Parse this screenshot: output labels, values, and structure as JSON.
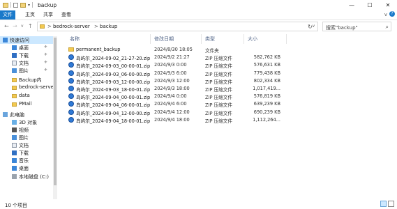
{
  "window": {
    "path_title": "backup",
    "controls": {
      "minimize": "—",
      "maximize": "☐",
      "close": "✕"
    }
  },
  "ribbon": {
    "tabs": [
      "文件",
      "主页",
      "共享",
      "查看"
    ],
    "expand": "v",
    "help": "?"
  },
  "address_bar": {
    "back": "←",
    "forward": "→",
    "recent": "v",
    "up": "↑",
    "crumbs": [
      "bedrock-server",
      "backup"
    ],
    "separator": ">",
    "dropdown": "v",
    "refresh": "↻",
    "search_placeholder": "搜索\"backup\"",
    "search_icon": "⌕"
  },
  "sidebar": {
    "items": [
      {
        "label": "快速访问",
        "icon": "star-icon",
        "pinned": false,
        "active": true
      },
      {
        "label": "桌面",
        "icon": "desktop-icon",
        "pinned": true
      },
      {
        "label": "下载",
        "icon": "download-icon",
        "pinned": true
      },
      {
        "label": "文档",
        "icon": "document-icon",
        "pinned": true
      },
      {
        "label": "图片",
        "icon": "picture-icon",
        "pinned": true
      },
      {
        "label": "Backup内",
        "icon": "folder-icon",
        "pinned": false
      },
      {
        "label": "bedrock-server",
        "icon": "folder-icon",
        "pinned": false
      },
      {
        "label": "data",
        "icon": "folder-icon",
        "pinned": false
      },
      {
        "label": "PMail",
        "icon": "folder-icon",
        "pinned": false
      },
      {
        "label": "此电脑",
        "icon": "pc-icon",
        "pinned": false
      },
      {
        "label": "3D 对象",
        "icon": "cube-icon",
        "pinned": false
      },
      {
        "label": "视频",
        "icon": "video-icon",
        "pinned": false
      },
      {
        "label": "图片",
        "icon": "picture-icon",
        "pinned": false
      },
      {
        "label": "文档",
        "icon": "document-icon",
        "pinned": false
      },
      {
        "label": "下载",
        "icon": "download-icon",
        "pinned": false
      },
      {
        "label": "音乐",
        "icon": "music-icon",
        "pinned": false
      },
      {
        "label": "桌面",
        "icon": "desktop-icon",
        "pinned": false
      },
      {
        "label": "本地磁盘 (C:)",
        "icon": "drive-icon",
        "pinned": false
      }
    ],
    "pin_glyph": "✈"
  },
  "columns": {
    "name": "名称",
    "date": "修改日期",
    "type": "类型",
    "size": "大小"
  },
  "files": [
    {
      "name": "permanent_backup",
      "date": "2024/8/30 18:05",
      "type": "文件夹",
      "size": "",
      "kind": "folder"
    },
    {
      "name": "岛屿尔_2024-09-02_21-27-20.zip",
      "date": "2024/9/2 21:27",
      "type": "ZIP 压缩文件",
      "size": "582,762 KB",
      "kind": "zip"
    },
    {
      "name": "岛屿尔_2024-09-03_00-00-01.zip",
      "date": "2024/9/3 0:00",
      "type": "ZIP 压缩文件",
      "size": "576,631 KB",
      "kind": "zip"
    },
    {
      "name": "岛屿尔_2024-09-03_06-00-00.zip",
      "date": "2024/9/3 6:00",
      "type": "ZIP 压缩文件",
      "size": "779,438 KB",
      "kind": "zip"
    },
    {
      "name": "岛屿尔_2024-09-03_12-00-00.zip",
      "date": "2024/9/3 12:00",
      "type": "ZIP 压缩文件",
      "size": "802,334 KB",
      "kind": "zip"
    },
    {
      "name": "岛屿尔_2024-09-03_18-00-01.zip",
      "date": "2024/9/3 18:00",
      "type": "ZIP 压缩文件",
      "size": "1,017,419...",
      "kind": "zip"
    },
    {
      "name": "岛屿尔_2024-09-04_00-00-01.zip",
      "date": "2024/9/4 0:00",
      "type": "ZIP 压缩文件",
      "size": "576,819 KB",
      "kind": "zip"
    },
    {
      "name": "岛屿尔_2024-09-04_06-00-01.zip",
      "date": "2024/9/4 6:00",
      "type": "ZIP 压缩文件",
      "size": "639,239 KB",
      "kind": "zip"
    },
    {
      "name": "岛屿尔_2024-09-04_12-00-00.zip",
      "date": "2024/9/4 12:00",
      "type": "ZIP 压缩文件",
      "size": "690,239 KB",
      "kind": "zip"
    },
    {
      "name": "岛屿尔_2024-09-04_18-00-01.zip",
      "date": "2024/9/4 18:00",
      "type": "ZIP 压缩文件",
      "size": "1,112,264...",
      "kind": "zip"
    }
  ],
  "status": {
    "count": "10 个项目"
  }
}
